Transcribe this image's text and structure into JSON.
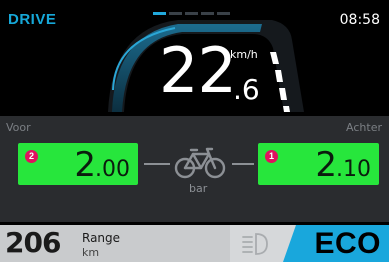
{
  "status": {
    "mode": "DRIVE",
    "time": "08:58"
  },
  "pager": [
    true,
    false,
    false,
    false,
    false
  ],
  "speed": {
    "integer": "22",
    "decimal": "6",
    "unit": "km/h"
  },
  "tires": {
    "front": {
      "label": "Voor",
      "badge": "2",
      "value_int": "2",
      "value_dec": "00"
    },
    "rear": {
      "label": "Achter",
      "badge": "1",
      "value_int": "2",
      "value_dec": "10"
    },
    "unit": "bar"
  },
  "range": {
    "value": "206",
    "label": "Range",
    "unit": "km"
  },
  "assist": {
    "level": "ECO"
  },
  "colors": {
    "accent": "#16a8d8",
    "tire": "#27e63c",
    "badge": "#e0115f",
    "eco": "#19a7dc"
  },
  "icons": {
    "bike": "bicycle-icon",
    "light": "headlight-icon"
  }
}
